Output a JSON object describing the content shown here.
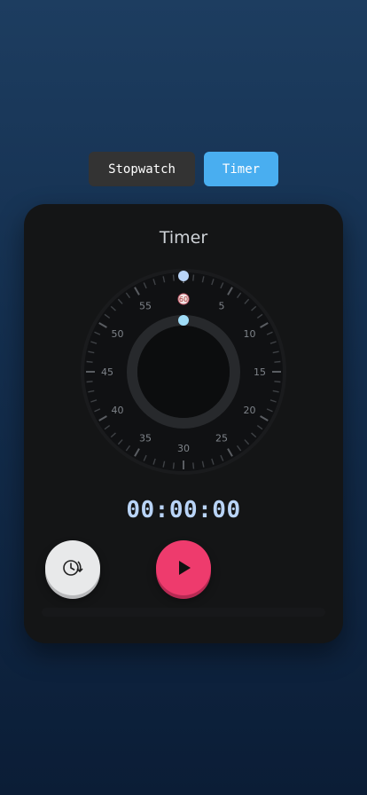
{
  "mode_switch": {
    "stopwatch_label": "Stopwatch",
    "timer_label": "Timer",
    "active": "Timer"
  },
  "card": {
    "title": "Timer",
    "time_display": "00:00:00"
  },
  "dial": {
    "labels": [
      "5",
      "10",
      "15",
      "20",
      "25",
      "30",
      "35",
      "40",
      "45",
      "50",
      "55"
    ],
    "center_top_label": "60",
    "outer_handle_value": 0,
    "inner_handle_value": 0
  },
  "controls": {
    "preset_icon": "clock-refresh-icon",
    "play_icon": "play-icon"
  },
  "colors": {
    "background_top": "#1d3d60",
    "background_bottom": "#0b1d36",
    "card": "#141516",
    "timer_tab": "#49aef0",
    "stopwatch_tab": "#333333",
    "play_button": "#ee3b6d",
    "time_text": "#b9d4f7"
  }
}
